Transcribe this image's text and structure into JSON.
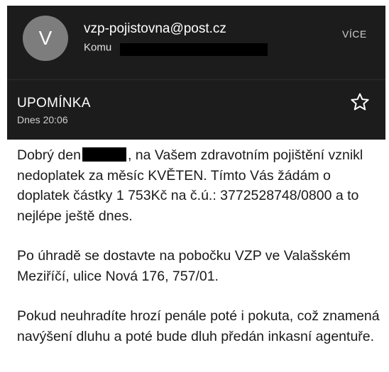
{
  "header": {
    "avatar_letter": "V",
    "sender_email": "vzp-pojistovna@post.cz",
    "to_label": "Komu",
    "more_label": "VÍCE",
    "subject": "UPOMÍNKA",
    "time": "Dnes 20:06",
    "star_icon": "star-outline-icon",
    "background_color": "#1c1c1c"
  },
  "message": {
    "p1_start": "Dobrý den",
    "p1_rest": ", na Vašem zdravotním pojištění vznikl nedoplatek za měsíc KVĚTEN. Tímto Vás žádám o doplatek částky 1 753Kč na č.ú.: 3772528748/0800 a to nejlépe ještě dnes.",
    "p2": "Po úhradě se dostavte na pobočku VZP ve Valašském Meziříčí, ulice Nová 176, 757/01.",
    "p3": "Pokud neuhradíte hrozí penále poté i pokuta, což znamená navýšení dluhu a poté bude dluh předán inkasní agentuře."
  }
}
